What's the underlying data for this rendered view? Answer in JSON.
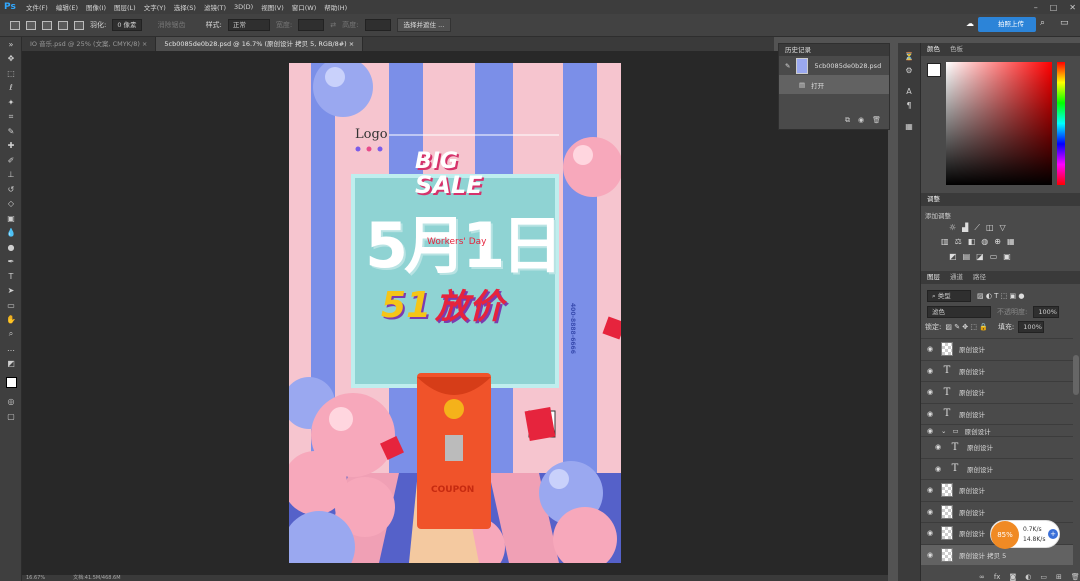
{
  "menubar": {
    "logo": "Ps",
    "items": [
      "文件(F)",
      "编辑(E)",
      "图像(I)",
      "图层(L)",
      "文字(Y)",
      "选择(S)",
      "滤镜(T)",
      "3D(D)",
      "视图(V)",
      "窗口(W)",
      "帮助(H)"
    ]
  },
  "options": {
    "feather_label": "羽化:",
    "feather_value": "0 像素",
    "antialias": "消除锯齿",
    "style_label": "样式:",
    "style_value": "正常",
    "width_label": "宽度:",
    "height_label": "高度:",
    "select_mask_button": "选择并遮住 ..."
  },
  "cloud_button": "拍照上传",
  "tabs": [
    "IO 音乐.psd @ 25% (文案, CMYK/8)",
    "5cb0085de0b28.psd @ 16.7% (原创设计 拷贝 5, RGB/8#)"
  ],
  "status": {
    "zoom": "16.67%",
    "doc": "文档:41.5M/468.6M"
  },
  "history": {
    "title": "历史记录",
    "snapshot": "5cb0085de0b28.psd",
    "step": "打开"
  },
  "color_panel": {
    "tabs": [
      "颜色",
      "色板"
    ]
  },
  "adjust_panel": {
    "title": "调整",
    "subtitle": "添加调整"
  },
  "layers_panel": {
    "tabs": [
      "图层",
      "通道",
      "路径"
    ],
    "kind_label": "类型",
    "blend_mode": "滤色",
    "opacity_label": "不透明度:",
    "opacity": "100%",
    "lock_label": "锁定:",
    "fill_label": "填充:",
    "fill": "100%",
    "layers": [
      {
        "type": "pixel",
        "name": "原创设计"
      },
      {
        "type": "text",
        "name": "原创设计"
      },
      {
        "type": "text",
        "name": "原创设计"
      },
      {
        "type": "text",
        "name": "原创设计"
      },
      {
        "type": "group",
        "name": "原创设计"
      },
      {
        "type": "text",
        "name": "原创设计"
      },
      {
        "type": "text",
        "name": "原创设计"
      },
      {
        "type": "pixel",
        "name": "原创设计"
      },
      {
        "type": "pixel",
        "name": "原创设计"
      },
      {
        "type": "pixel",
        "name": "原创设计"
      },
      {
        "type": "pixel",
        "name": "原创设计 拷贝 5"
      }
    ]
  },
  "net_widget": {
    "percent": "85%",
    "up": "0.7K/s",
    "down": "14.8K/s"
  },
  "poster": {
    "logo": "Logo",
    "big": "BIG",
    "sale": "SALE",
    "date": "5月1日",
    "workers_day": "Workers' Day",
    "slogan_num": "51",
    "slogan_text": "放价",
    "coupon": "COUPON",
    "hotline": "400-8888-6666"
  },
  "colors": {
    "accent": "#31a8ff",
    "poster_teal": "#8fd3d3",
    "stripe_blue": "#7b8fe8",
    "stripe_pink": "#f6c5cf",
    "envelope": "#f0532a"
  }
}
